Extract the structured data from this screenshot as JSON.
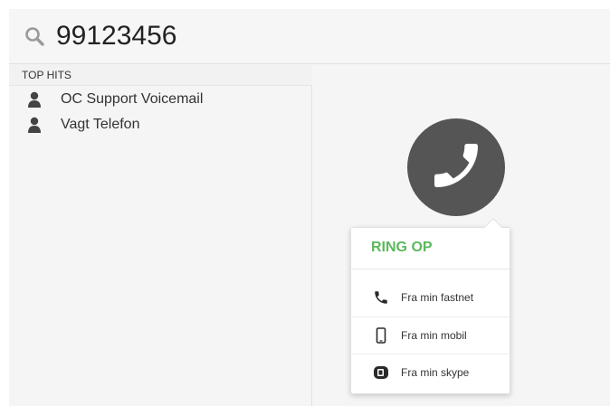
{
  "search": {
    "query": "99123456",
    "icon": "search-icon"
  },
  "results": {
    "section_label": "TOP HITS",
    "items": [
      {
        "name": "OC Support Voicemail",
        "icon": "person-icon"
      },
      {
        "name": "Vagt Telefon",
        "icon": "person-icon"
      }
    ]
  },
  "call": {
    "icon": "phone-icon",
    "popover": {
      "title": "RING OP",
      "options": [
        {
          "label": "Fra min fastnet",
          "icon": "phone-handset-icon"
        },
        {
          "label": "Fra min mobil",
          "icon": "mobile-phone-icon"
        },
        {
          "label": "Fra min skype",
          "icon": "skype-icon"
        }
      ]
    }
  },
  "colors": {
    "accent_green": "#5cb85c",
    "call_button": "#555555",
    "background": "#f5f5f5"
  }
}
